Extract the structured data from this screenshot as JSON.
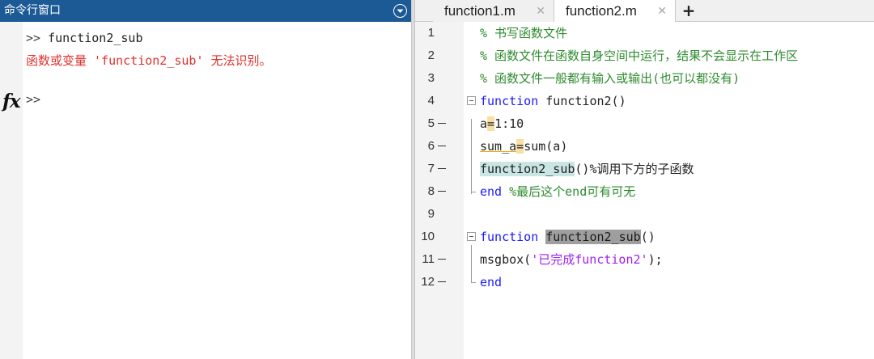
{
  "command_window": {
    "title": "命令行窗口",
    "lines": [
      {
        "prompt": ">>",
        "text": " function2_sub"
      },
      {
        "error": "函数或变量 'function2_sub' 无法识别。"
      }
    ],
    "fx_label": "fx",
    "prompt": ">>"
  },
  "editor": {
    "tabs": [
      {
        "label": "function1.m",
        "active": false
      },
      {
        "label": "function2.m",
        "active": true
      }
    ],
    "close_glyph": "✕",
    "add_tab_label": "+",
    "lines": [
      {
        "num": "1",
        "text": "% 书写函数文件"
      },
      {
        "num": "2",
        "text": "% 函数文件在函数自身空间中运行，结果不会显示在工作区"
      },
      {
        "num": "3",
        "text": "% 函数文件一般都有输入或输出(也可以都没有)"
      },
      {
        "num": "4",
        "kw": "function",
        "rest": " function2()"
      },
      {
        "num": "5",
        "a": "a",
        "eq": "=",
        "b": "1:10"
      },
      {
        "num": "6",
        "a": "sum_a",
        "eq": "=",
        "b": "sum(a)"
      },
      {
        "num": "7",
        "hl": "function2_sub",
        "rest": "()%调用下方的子函数"
      },
      {
        "num": "8",
        "kw": "end",
        "rest": " %最后这个end可有可无"
      },
      {
        "num": "9"
      },
      {
        "num": "10",
        "kw": "function",
        "hl": "function2_sub",
        "rest": "()"
      },
      {
        "num": "11",
        "a": "msgbox(",
        "str": "'已完成function2'",
        "rest": ");"
      },
      {
        "num": "12",
        "kw": "end"
      }
    ]
  },
  "colors": {
    "header_blue": "#1c5a95",
    "comment_green": "#2e8b2e",
    "keyword_blue": "#1a1aff",
    "string_purple": "#a020f0",
    "error_red": "#e0322d"
  }
}
